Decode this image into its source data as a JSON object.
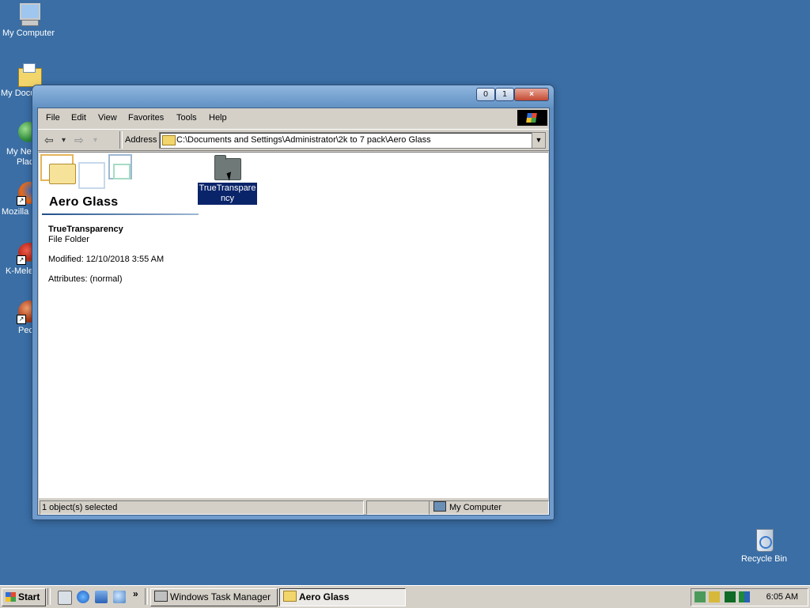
{
  "desktop": {
    "icons": [
      {
        "label": "My Computer"
      },
      {
        "label": "My Docu"
      },
      {
        "label": "My Net",
        "label2": "Place"
      },
      {
        "label": "Mozilla F"
      },
      {
        "label": "K-Meleo"
      },
      {
        "label": "Pec"
      },
      {
        "label": "Recycle Bin"
      }
    ]
  },
  "window": {
    "caption_buttons": {
      "minimize": "0",
      "maximize": "1",
      "close": "×"
    },
    "menu": [
      "File",
      "Edit",
      "View",
      "Favorites",
      "Tools",
      "Help"
    ],
    "toolbar": {
      "back": "⇦",
      "back_drop": "▾",
      "forward": "⇨",
      "forward_drop": "▾"
    },
    "address": {
      "label": "Address",
      "value": "C:\\Documents and Settings\\Administrator\\2k to 7 pack\\Aero Glass",
      "drop": "▼"
    },
    "banner_title": "Aero Glass",
    "details": {
      "name": "TrueTransparency",
      "type": "File Folder",
      "modified": "Modified: 12/10/2018 3:55 AM",
      "attributes": "Attributes: (normal)"
    },
    "items": [
      {
        "label": "TrueTransparency",
        "selected": true
      }
    ],
    "status": {
      "selected": "1 object(s) selected",
      "middle": "",
      "location": "My Computer"
    }
  },
  "taskbar": {
    "start_label": "Start",
    "quicklaunch_more": "»",
    "tasks": [
      {
        "label": "Windows Task Manager",
        "active": false
      },
      {
        "label": "Aero Glass",
        "active": true
      }
    ],
    "clock": "6:05 AM"
  },
  "colors": {
    "desktop": "#3a6ea5",
    "selection": "#0a246a",
    "face": "#d4d0c8"
  }
}
